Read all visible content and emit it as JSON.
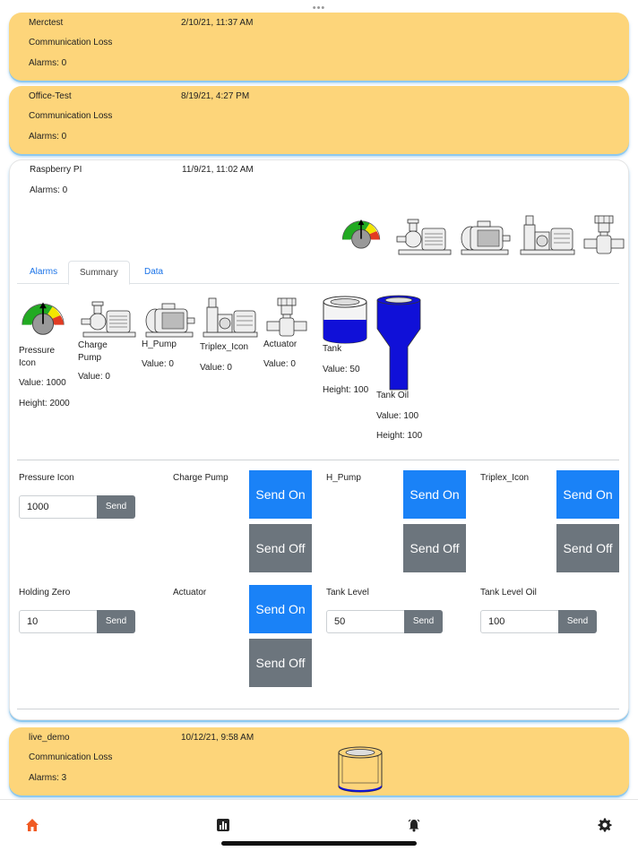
{
  "cards": [
    {
      "name": "Merctest",
      "time": "2/10/21, 11:37 AM",
      "status": "Communication Loss",
      "alarms": "Alarms: 0"
    },
    {
      "name": "Office-Test",
      "time": "8/19/21, 4:27 PM",
      "status": "Communication Loss",
      "alarms": "Alarms: 0"
    },
    {
      "name": "Raspberry PI",
      "time": "11/9/21, 11:02 AM",
      "alarms": "Alarms: 0"
    },
    {
      "name": "live_demo",
      "time": "10/12/21, 9:58 AM",
      "status": "Communication Loss",
      "alarms": "Alarms: 3"
    }
  ],
  "tabs": [
    "Alarms",
    "Summary",
    "Data"
  ],
  "summary": {
    "pressure": {
      "name": "Pressure Icon",
      "value": "Value: 1000",
      "height": "Height: 2000"
    },
    "charge": {
      "name": "Charge Pump",
      "value": "Value: 0"
    },
    "hpump": {
      "name": "H_Pump",
      "value": "Value: 0"
    },
    "triplex": {
      "name": "Triplex_Icon",
      "value": "Value: 0"
    },
    "actuator": {
      "name": "Actuator",
      "value": "Value: 0"
    },
    "tank": {
      "name": "Tank",
      "value": "Value: 50",
      "height": "Height: 100"
    },
    "tankoil": {
      "name": "Tank Oil",
      "value": "Value: 100",
      "height": "Height: 100"
    }
  },
  "controls": {
    "pressure": {
      "label": "Pressure Icon",
      "value": "1000"
    },
    "charge": {
      "label": "Charge Pump"
    },
    "hpump": {
      "label": "H_Pump"
    },
    "triplex": {
      "label": "Triplex_Icon"
    },
    "holding": {
      "label": "Holding Zero",
      "value": "10"
    },
    "actuator": {
      "label": "Actuator"
    },
    "tanklevel": {
      "label": "Tank Level",
      "value": "50"
    },
    "tankleveloil": {
      "label": "Tank Level Oil",
      "value": "100"
    },
    "send": "Send",
    "send_on": "Send On",
    "send_off": "Send Off"
  },
  "levels": {
    "tank_fill": 0.5,
    "tank_oil_fill": 1.0
  },
  "colors": {
    "loss_card": "#fdd57a",
    "primary": "#1a82f7",
    "secondary": "#6c757d",
    "nav_active": "#f05a23",
    "tank_fill": "#1010d8"
  },
  "nav": [
    "home-icon",
    "chart-icon",
    "alarm-bell-icon",
    "gear-icon"
  ]
}
